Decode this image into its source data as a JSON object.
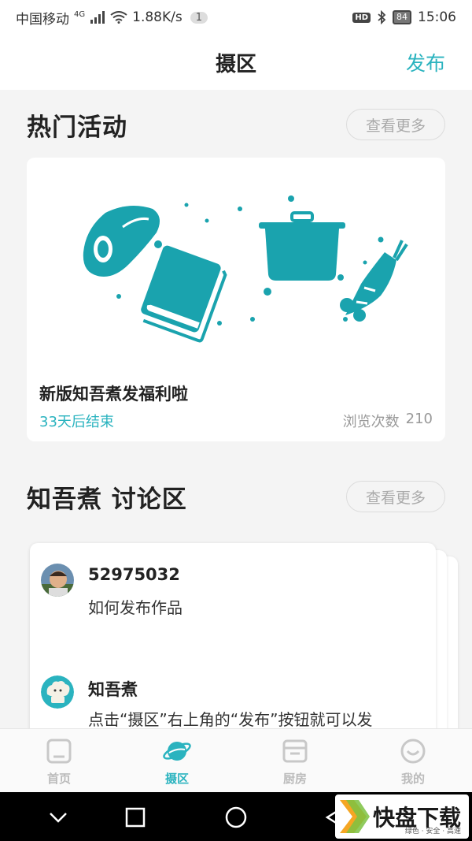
{
  "status_bar": {
    "carrier": "中国移动",
    "network": "4G",
    "speed": "1.88K/s",
    "notification_count": "1",
    "hd": "HD",
    "battery": "84",
    "time": "15:06"
  },
  "header": {
    "title": "摄区",
    "publish_label": "发布"
  },
  "hot_activities": {
    "section_title": "热门活动",
    "more_label": "查看更多",
    "card": {
      "title": "新版知吾煮发福利啦",
      "remaining": "33天后结束",
      "views_label": "浏览次数",
      "views_count": "210",
      "illustration_icons": [
        "meat-icon",
        "book-icon",
        "pot-icon",
        "carrot-icon"
      ]
    }
  },
  "discussion": {
    "section_title": "知吾煮 讨论区",
    "more_label": "查看更多",
    "posts": [
      {
        "user": "52975032",
        "text": "如何发布作品"
      },
      {
        "user": "知吾煮",
        "text": "点击“摄区”右上角的“发布”按钮就可以发"
      }
    ]
  },
  "tab_bar": {
    "tabs": [
      {
        "label": "首页",
        "icon": "home-icon",
        "active": false
      },
      {
        "label": "摄区",
        "icon": "planet-icon",
        "active": true
      },
      {
        "label": "厨房",
        "icon": "kitchen-icon",
        "active": false
      },
      {
        "label": "我的",
        "icon": "smile-icon",
        "active": false
      }
    ]
  },
  "watermark": {
    "text": "快盘下载",
    "sub": "绿色 · 安全 · 高速"
  },
  "colors": {
    "accent": "#2ab3bf",
    "illustration": "#1aa3ae"
  }
}
